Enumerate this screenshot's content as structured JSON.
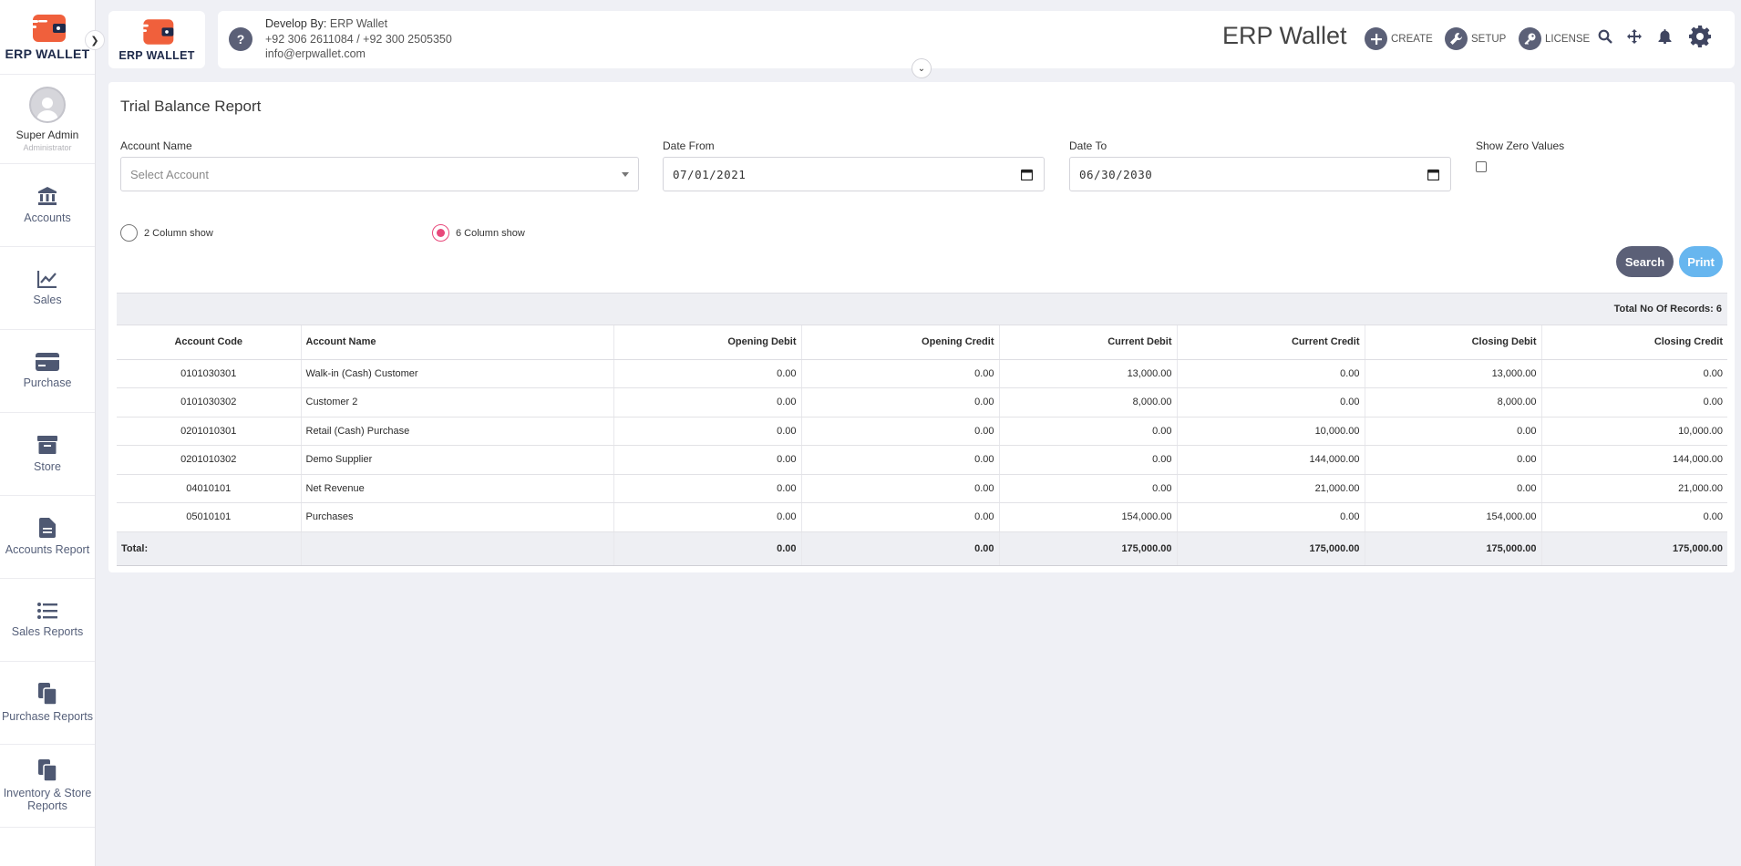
{
  "brand": {
    "logo_text": "ERP WALLET",
    "app_title": "ERP Wallet",
    "accent": "#f0603c",
    "primary": "#5b6077"
  },
  "user": {
    "name": "Super Admin",
    "role": "Administrator"
  },
  "sidebar": {
    "items": [
      {
        "label": "Accounts",
        "icon": "bank-icon"
      },
      {
        "label": "Sales",
        "icon": "chart-line-icon"
      },
      {
        "label": "Purchase",
        "icon": "credit-card-icon"
      },
      {
        "label": "Store",
        "icon": "archive-box-icon"
      },
      {
        "label": "Accounts Report",
        "icon": "file-text-icon"
      },
      {
        "label": "Sales Reports",
        "icon": "list-icon"
      },
      {
        "label": "Purchase Reports",
        "icon": "copy-icon"
      },
      {
        "label": "Inventory & Store Reports",
        "icon": "documents-icon"
      }
    ]
  },
  "header": {
    "dev_prefix": "Develop By:",
    "dev_name": "ERP Wallet",
    "phones": "+92 306 2611084 / +92 300 2505350",
    "email": "info@erpwallet.com",
    "actions": {
      "create": "CREATE",
      "setup": "SETUP",
      "license": "LICENSE"
    }
  },
  "report": {
    "title": "Trial Balance Report",
    "filters": {
      "account_label": "Account Name",
      "account_placeholder": "Select Account",
      "date_from_label": "Date From",
      "date_from": "07/01/2021",
      "date_to_label": "Date To",
      "date_to": "06/30/2030",
      "zero_label": "Show Zero Values"
    },
    "radio_2col": "2 Column show",
    "radio_6col": "6 Column show",
    "search_btn": "Search",
    "print_btn": "Print",
    "records_text": "Total No Of Records: 6",
    "columns": [
      "Account Code",
      "Account Name",
      "Opening Debit",
      "Opening Credit",
      "Current Debit",
      "Current Credit",
      "Closing Debit",
      "Closing Credit"
    ],
    "rows": [
      [
        "0101030301",
        "Walk-in (Cash) Customer",
        "0.00",
        "0.00",
        "13,000.00",
        "0.00",
        "13,000.00",
        "0.00"
      ],
      [
        "0101030302",
        "Customer 2",
        "0.00",
        "0.00",
        "8,000.00",
        "0.00",
        "8,000.00",
        "0.00"
      ],
      [
        "0201010301",
        "Retail (Cash) Purchase",
        "0.00",
        "0.00",
        "0.00",
        "10,000.00",
        "0.00",
        "10,000.00"
      ],
      [
        "0201010302",
        "Demo Supplier",
        "0.00",
        "0.00",
        "0.00",
        "144,000.00",
        "0.00",
        "144,000.00"
      ],
      [
        "04010101",
        "Net Revenue",
        "0.00",
        "0.00",
        "0.00",
        "21,000.00",
        "0.00",
        "21,000.00"
      ],
      [
        "05010101",
        "Purchases",
        "0.00",
        "0.00",
        "154,000.00",
        "0.00",
        "154,000.00",
        "0.00"
      ]
    ],
    "total_label": "Total:",
    "totals": [
      "0.00",
      "0.00",
      "175,000.00",
      "175,000.00",
      "175,000.00",
      "175,000.00"
    ]
  }
}
